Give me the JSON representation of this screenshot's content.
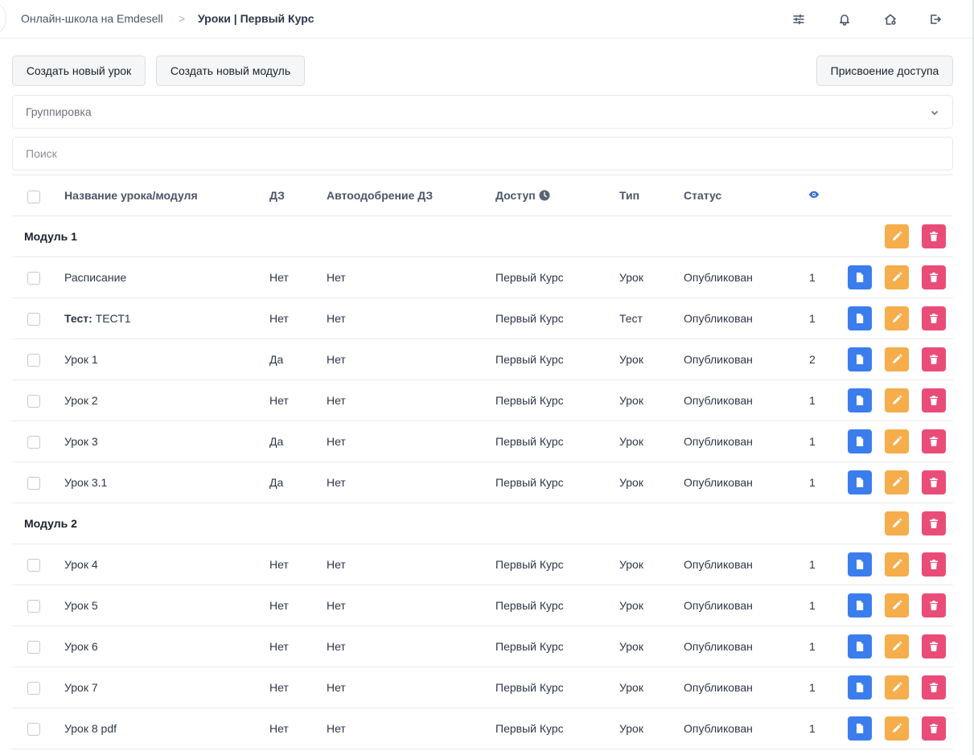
{
  "breadcrumb": {
    "root": "Онлайн-школа на Emdesell",
    "separator": ">",
    "current": "Уроки | Первый Курс"
  },
  "header_icons": [
    "sliders-icon",
    "bell-icon",
    "home-settings-icon",
    "logout-icon"
  ],
  "toolbar": {
    "new_lesson": "Создать новый урок",
    "new_module": "Создать новый модуль",
    "assign_access": "Присвоение доступа"
  },
  "grouping": {
    "placeholder": "Группировка"
  },
  "search": {
    "placeholder": "Поиск"
  },
  "table": {
    "headers": {
      "name": "Название урока/модуля",
      "hw": "ДЗ",
      "auto": "Автоодобрение ДЗ",
      "access": "Доступ",
      "type": "Тип",
      "status": "Статус",
      "views_icon": "eye-icon"
    },
    "modules": [
      {
        "title": "Модуль 1",
        "rows": [
          {
            "prefix": "",
            "name": "Расписание",
            "hw": "Нет",
            "auto": "Нет",
            "access": "Первый Курс",
            "type": "Урок",
            "status": "Опубликован",
            "views": "1"
          },
          {
            "prefix": "Тест:",
            "name": "ТЕСТ1",
            "hw": "Нет",
            "auto": "Нет",
            "access": "Первый Курс",
            "type": "Тест",
            "status": "Опубликован",
            "views": "1"
          },
          {
            "prefix": "",
            "name": "Урок 1",
            "hw": "Да",
            "auto": "Нет",
            "access": "Первый Курс",
            "type": "Урок",
            "status": "Опубликован",
            "views": "2"
          },
          {
            "prefix": "",
            "name": "Урок 2",
            "hw": "Нет",
            "auto": "Нет",
            "access": "Первый Курс",
            "type": "Урок",
            "status": "Опубликован",
            "views": "1"
          },
          {
            "prefix": "",
            "name": "Урок 3",
            "hw": "Да",
            "auto": "Нет",
            "access": "Первый Курс",
            "type": "Урок",
            "status": "Опубликован",
            "views": "1"
          },
          {
            "prefix": "",
            "name": "Урок 3.1",
            "hw": "Да",
            "auto": "Нет",
            "access": "Первый Курс",
            "type": "Урок",
            "status": "Опубликован",
            "views": "1"
          }
        ]
      },
      {
        "title": "Модуль 2",
        "rows": [
          {
            "prefix": "",
            "name": "Урок 4",
            "hw": "Нет",
            "auto": "Нет",
            "access": "Первый Курс",
            "type": "Урок",
            "status": "Опубликован",
            "views": "1"
          },
          {
            "prefix": "",
            "name": "Урок 5",
            "hw": "Нет",
            "auto": "Нет",
            "access": "Первый Курс",
            "type": "Урок",
            "status": "Опубликован",
            "views": "1"
          },
          {
            "prefix": "",
            "name": "Урок 6",
            "hw": "Нет",
            "auto": "Нет",
            "access": "Первый Курс",
            "type": "Урок",
            "status": "Опубликован",
            "views": "1"
          },
          {
            "prefix": "",
            "name": "Урок 7",
            "hw": "Нет",
            "auto": "Нет",
            "access": "Первый Курс",
            "type": "Урок",
            "status": "Опубликован",
            "views": "1"
          },
          {
            "prefix": "",
            "name": "Урок 8 pdf",
            "hw": "Нет",
            "auto": "Нет",
            "access": "Первый Курс",
            "type": "Урок",
            "status": "Опубликован",
            "views": "1"
          }
        ]
      }
    ]
  },
  "colors": {
    "view_button": "#3b7ded",
    "edit_button": "#f6ad4b",
    "delete_button": "#ea4c78",
    "eye_icon": "#3b6fd6"
  }
}
